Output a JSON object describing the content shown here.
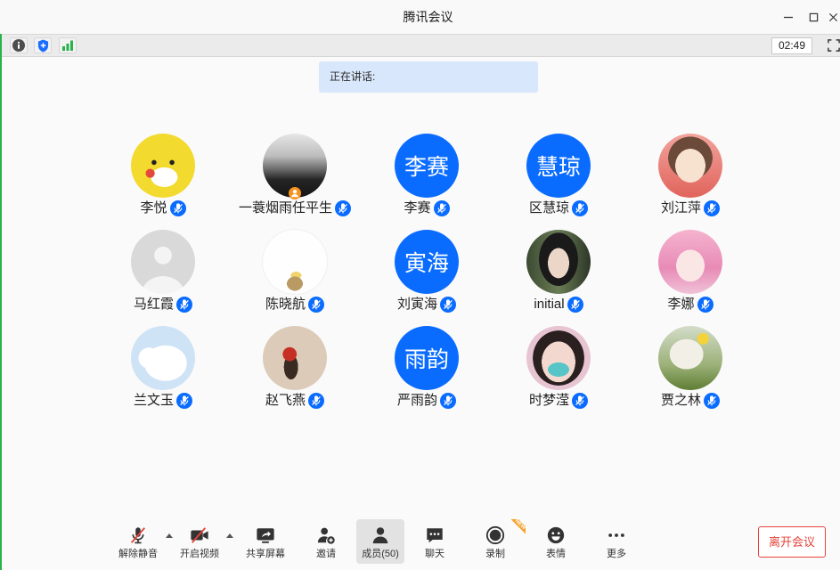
{
  "window": {
    "title": "腾讯会议",
    "controls": [
      "minimize-icon",
      "maximize-icon",
      "close-icon"
    ]
  },
  "status_bar": {
    "icons": [
      "info-icon",
      "security-shield-icon",
      "network-signal-icon"
    ],
    "timer": "02:49",
    "fullscreen_icon": "fullscreen-icon"
  },
  "speaking": {
    "label": "正在讲话:"
  },
  "participant_mic_icon": "mic-muted-icon",
  "participants": [
    {
      "name": "李悦"
    },
    {
      "name": "一蓑烟雨任平生",
      "badge_icon": "host-badge-icon"
    },
    {
      "name": "李赛",
      "avatar_text": "李赛"
    },
    {
      "name": "区慧琼",
      "avatar_text": "慧琼"
    },
    {
      "name": "刘江萍"
    },
    {
      "name": "马红霞"
    },
    {
      "name": "陈晓航"
    },
    {
      "name": "刘寅海",
      "avatar_text": "寅海"
    },
    {
      "name": "initial"
    },
    {
      "name": "李娜"
    },
    {
      "name": "兰文玉"
    },
    {
      "name": "赵飞燕"
    },
    {
      "name": "严雨韵",
      "avatar_text": "雨韵"
    },
    {
      "name": "时梦滢"
    },
    {
      "name": "贾之林"
    }
  ],
  "toolbar": {
    "buttons": [
      {
        "label": "解除静音",
        "icon": "mic-muted-icon",
        "has_menu": true
      },
      {
        "label": "开启视频",
        "icon": "video-off-icon",
        "has_menu": true
      },
      {
        "label": "共享屏幕",
        "icon": "share-screen-icon"
      },
      {
        "label": "邀请",
        "icon": "invite-user-icon"
      },
      {
        "label": "成员(50)",
        "icon": "members-icon",
        "active": true
      },
      {
        "label": "聊天",
        "icon": "chat-icon"
      },
      {
        "label": "录制",
        "icon": "record-icon",
        "badge": "NEW"
      },
      {
        "label": "表情",
        "icon": "emoji-icon"
      },
      {
        "label": "更多",
        "icon": "more-icon"
      }
    ],
    "leave_label": "离开会议"
  },
  "colors": {
    "accent": "#0a6cff",
    "leave": "#e5433b",
    "new_badge": "#f7a12b",
    "speaking_bg": "#d8e7fb",
    "signal": "#27b34a",
    "mute_slash": "#e5433b"
  }
}
